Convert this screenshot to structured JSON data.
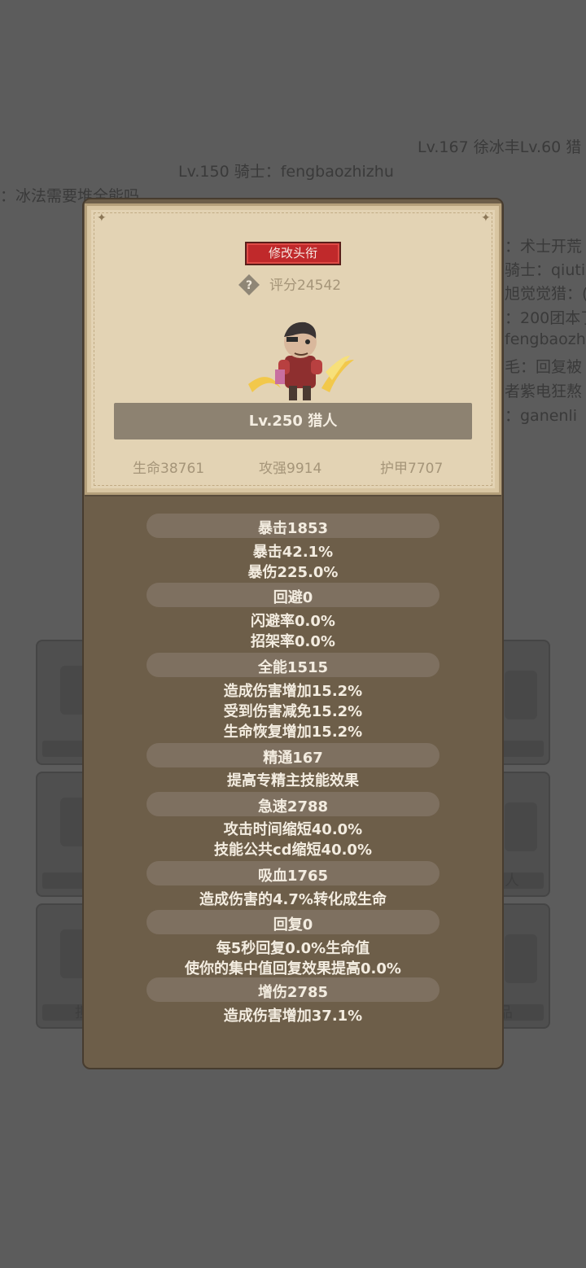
{
  "background_chat": [
    "Lv.167 徐冰丰Lv.60 猎",
    "Lv.150 骑士：fengbaozhizhu",
    "：冰法需要堆全能吗",
    "：术士开荒",
    "骑士：qiuti",
    "旭觉觉猎：(",
    "：200团本了",
    "fengbaozh",
    "毛：回复被",
    "者紫电狂熬",
    "：ganenli"
  ],
  "background_labels": [
    "人",
    "担",
    "品"
  ],
  "profile": {
    "change_title_button": "修改头衔",
    "score": "评分24542",
    "name": "Lv.250 猎人",
    "hp": "生命38761",
    "attack": "攻强9914",
    "armor": "护甲7707"
  },
  "attributes": [
    {
      "title": "暴击1853",
      "details": [
        "暴击42.1%",
        "暴伤225.0%"
      ]
    },
    {
      "title": "回避0",
      "details": [
        "闪避率0.0%",
        "招架率0.0%"
      ]
    },
    {
      "title": "全能1515",
      "details": [
        "造成伤害增加15.2%",
        "受到伤害减免15.2%",
        "生命恢复增加15.2%"
      ]
    },
    {
      "title": "精通167",
      "details": [
        "提高专精主技能效果"
      ]
    },
    {
      "title": "急速2788",
      "details": [
        "攻击时间缩短40.0%",
        "技能公共cd缩短40.0%"
      ]
    },
    {
      "title": "吸血1765",
      "details": [
        "造成伤害的4.7%转化成生命"
      ]
    },
    {
      "title": "回复0",
      "details": [
        "每5秒回复0.0%生命值",
        "使你的集中值回复效果提高0.0%"
      ]
    },
    {
      "title": "增伤2785",
      "details": [
        "造成伤害增加37.1%"
      ]
    }
  ],
  "colors": {
    "overlay": "#5c5c5c",
    "panel": "#6d5e49",
    "card": "#e3d3b4",
    "button_red": "#c0292b"
  }
}
